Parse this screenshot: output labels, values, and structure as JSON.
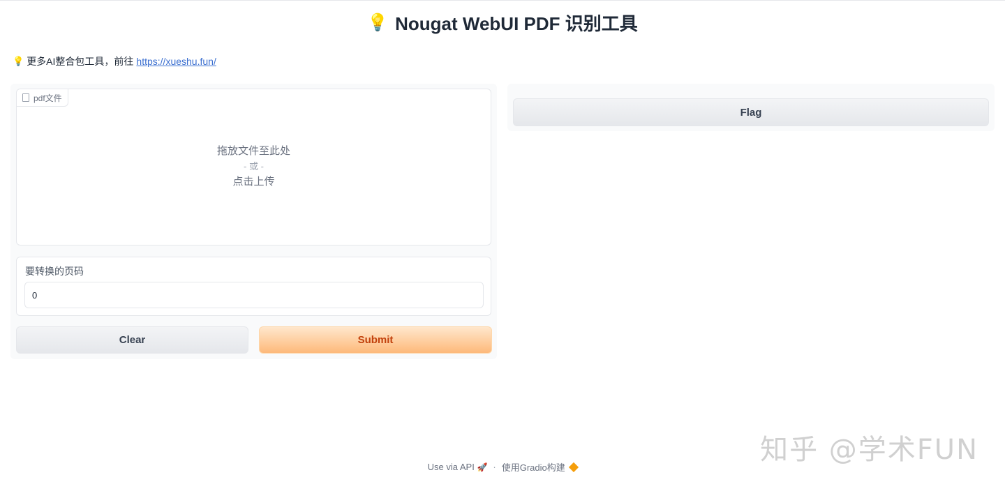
{
  "header": {
    "title_icon": "lightbulb-icon",
    "title": "Nougat WebUI PDF 识别工具"
  },
  "notice": {
    "text": "更多AI整合包工具，前往",
    "link": "https://xueshu.fun/"
  },
  "upload": {
    "label": "pdf文件",
    "drop_text": "拖放文件至此处",
    "or_text": "- 或 -",
    "click_text": "点击上传"
  },
  "page_field": {
    "label": "要转换的页码",
    "value": "0"
  },
  "buttons": {
    "clear": "Clear",
    "submit": "Submit",
    "flag": "Flag"
  },
  "footer": {
    "api": "Use via API",
    "separator": "·",
    "built_with": "使用Gradio构建"
  },
  "watermark": "知乎 @学术FUN",
  "colors": {
    "accent": "#fdb97a",
    "link": "#3b6fd0"
  }
}
